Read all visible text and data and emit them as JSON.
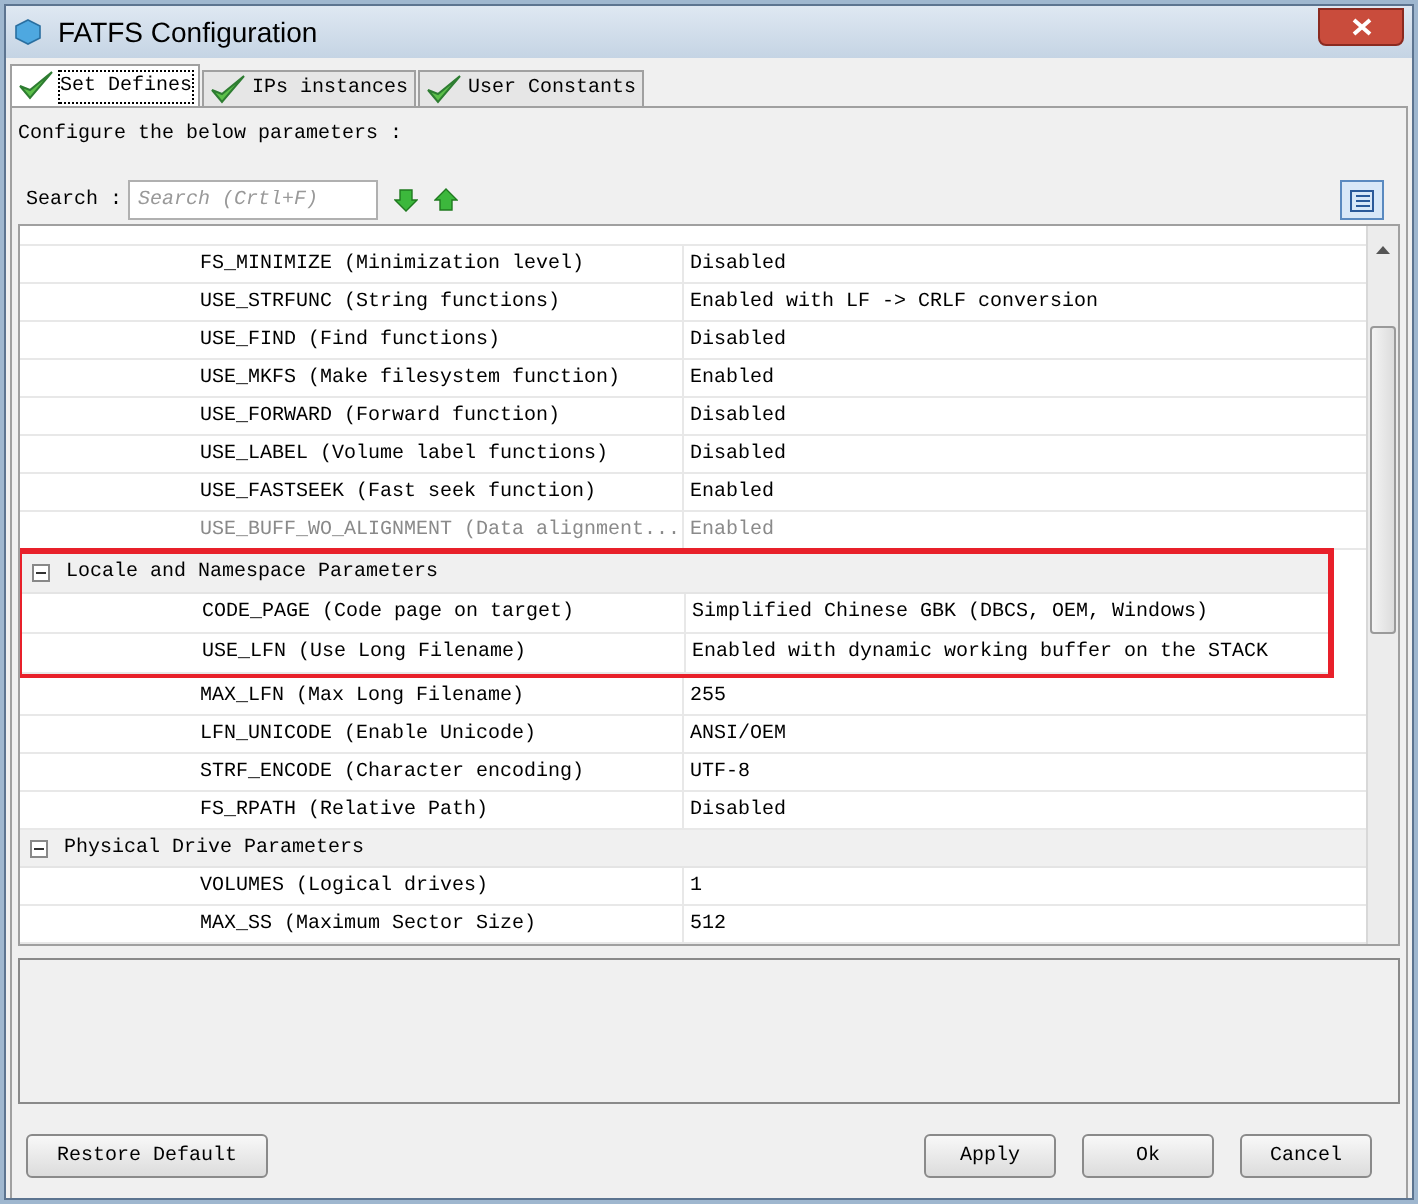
{
  "window": {
    "title": "FATFS Configuration"
  },
  "tabs": [
    {
      "label": "Set Defines",
      "selected": true
    },
    {
      "label": "IPs instances",
      "selected": false
    },
    {
      "label": "User Constants",
      "selected": false
    }
  ],
  "intro": "Configure the below parameters :",
  "search": {
    "label": "Search :",
    "placeholder": "Search (Crtl+F)"
  },
  "rows": [
    {
      "kind": "param",
      "name": "FS_MINIMIZE (Minimization level)",
      "value": "Disabled",
      "disabled": false,
      "highlighted": false
    },
    {
      "kind": "param",
      "name": "USE_STRFUNC (String functions)",
      "value": "Enabled with LF -> CRLF conversion",
      "disabled": false,
      "highlighted": false
    },
    {
      "kind": "param",
      "name": "USE_FIND (Find functions)",
      "value": "Disabled",
      "disabled": false,
      "highlighted": false
    },
    {
      "kind": "param",
      "name": "USE_MKFS (Make filesystem function)",
      "value": "Enabled",
      "disabled": false,
      "highlighted": false
    },
    {
      "kind": "param",
      "name": "USE_FORWARD (Forward function)",
      "value": "Disabled",
      "disabled": false,
      "highlighted": false
    },
    {
      "kind": "param",
      "name": "USE_LABEL (Volume label functions)",
      "value": "Disabled",
      "disabled": false,
      "highlighted": false
    },
    {
      "kind": "param",
      "name": "USE_FASTSEEK (Fast seek function)",
      "value": "Enabled",
      "disabled": false,
      "highlighted": false
    },
    {
      "kind": "param",
      "name": "USE_BUFF_WO_ALIGNMENT (Data alignment...",
      "value": "Enabled",
      "disabled": true,
      "highlighted": false
    },
    {
      "kind": "group",
      "name": "Locale and Namespace Parameters",
      "expanded": true,
      "highlighted": true
    },
    {
      "kind": "param",
      "name": "CODE_PAGE (Code page on target)",
      "value": "Simplified Chinese GBK (DBCS, OEM, Windows)",
      "disabled": false,
      "highlighted": true
    },
    {
      "kind": "param",
      "name": "USE_LFN (Use Long Filename)",
      "value": "Enabled with dynamic working buffer on the STACK",
      "disabled": false,
      "highlighted": true
    },
    {
      "kind": "param",
      "name": "MAX_LFN (Max Long Filename)",
      "value": "255",
      "disabled": false,
      "highlighted": false
    },
    {
      "kind": "param",
      "name": "LFN_UNICODE (Enable Unicode)",
      "value": "ANSI/OEM",
      "disabled": false,
      "highlighted": false
    },
    {
      "kind": "param",
      "name": "STRF_ENCODE (Character encoding)",
      "value": "UTF-8",
      "disabled": false,
      "highlighted": false
    },
    {
      "kind": "param",
      "name": "FS_RPATH (Relative Path)",
      "value": "Disabled",
      "disabled": false,
      "highlighted": false
    },
    {
      "kind": "group",
      "name": "Physical Drive Parameters",
      "expanded": true,
      "highlighted": false
    },
    {
      "kind": "param",
      "name": "VOLUMES (Logical drives)",
      "value": "1",
      "disabled": false,
      "highlighted": false
    },
    {
      "kind": "param",
      "name": "MAX_SS (Maximum Sector Size)",
      "value": "512",
      "disabled": false,
      "highlighted": false
    }
  ],
  "buttons": {
    "left": [
      "Restore Default"
    ],
    "right": [
      "Apply",
      "Ok",
      "Cancel"
    ]
  }
}
